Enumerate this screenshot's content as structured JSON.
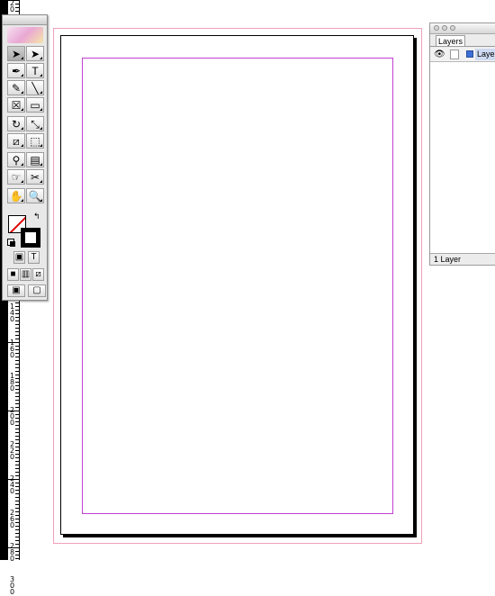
{
  "ruler": {
    "labels": [
      "20",
      "140",
      "160",
      "180",
      "200",
      "220",
      "240",
      "260",
      "280",
      "300"
    ]
  },
  "tools": {
    "rows": [
      [
        "selection-arrow-icon",
        "direct-selection-arrow-icon"
      ],
      [
        "pen-icon",
        "type-icon"
      ],
      [
        "pencil-icon",
        "line-icon"
      ],
      [
        "rectangle-frame-icon",
        "rectangle-icon"
      ],
      [
        "rotate-icon",
        "scale-icon"
      ],
      [
        "shear-icon",
        "free-transform-icon"
      ],
      [
        "eyedropper-icon",
        "gradient-icon"
      ],
      [
        "button-icon",
        "scissors-icon"
      ],
      [
        "hand-icon",
        "zoom-icon"
      ]
    ],
    "glyphs": {
      "selection-arrow-icon": "➤",
      "direct-selection-arrow-icon": "➤",
      "pen-icon": "✒",
      "type-icon": "T",
      "pencil-icon": "✎",
      "line-icon": "╲",
      "rectangle-frame-icon": "☒",
      "rectangle-icon": "▭",
      "rotate-icon": "↻",
      "scale-icon": "⤡",
      "shear-icon": "⧄",
      "free-transform-icon": "⬚",
      "eyedropper-icon": "⚲",
      "gradient-icon": "▤",
      "button-icon": "☞",
      "scissors-icon": "✂",
      "hand-icon": "✋",
      "zoom-icon": "🔍",
      "formatting-container-icon": "▣",
      "formatting-text-icon": "T",
      "apply-color-icon": "■",
      "apply-gradient-icon": "▥",
      "apply-none-icon": "⧄",
      "normal-view-icon": "▣",
      "preview-view-icon": "▢"
    }
  },
  "layers_panel": {
    "tab_label": "Layers",
    "layer_name": "Layer",
    "footer_text": "1 Layer",
    "layer_color": "#3c6fd6"
  },
  "document": {
    "bleed_color": "#f0a0b8",
    "margin_color": "#c040d0"
  }
}
